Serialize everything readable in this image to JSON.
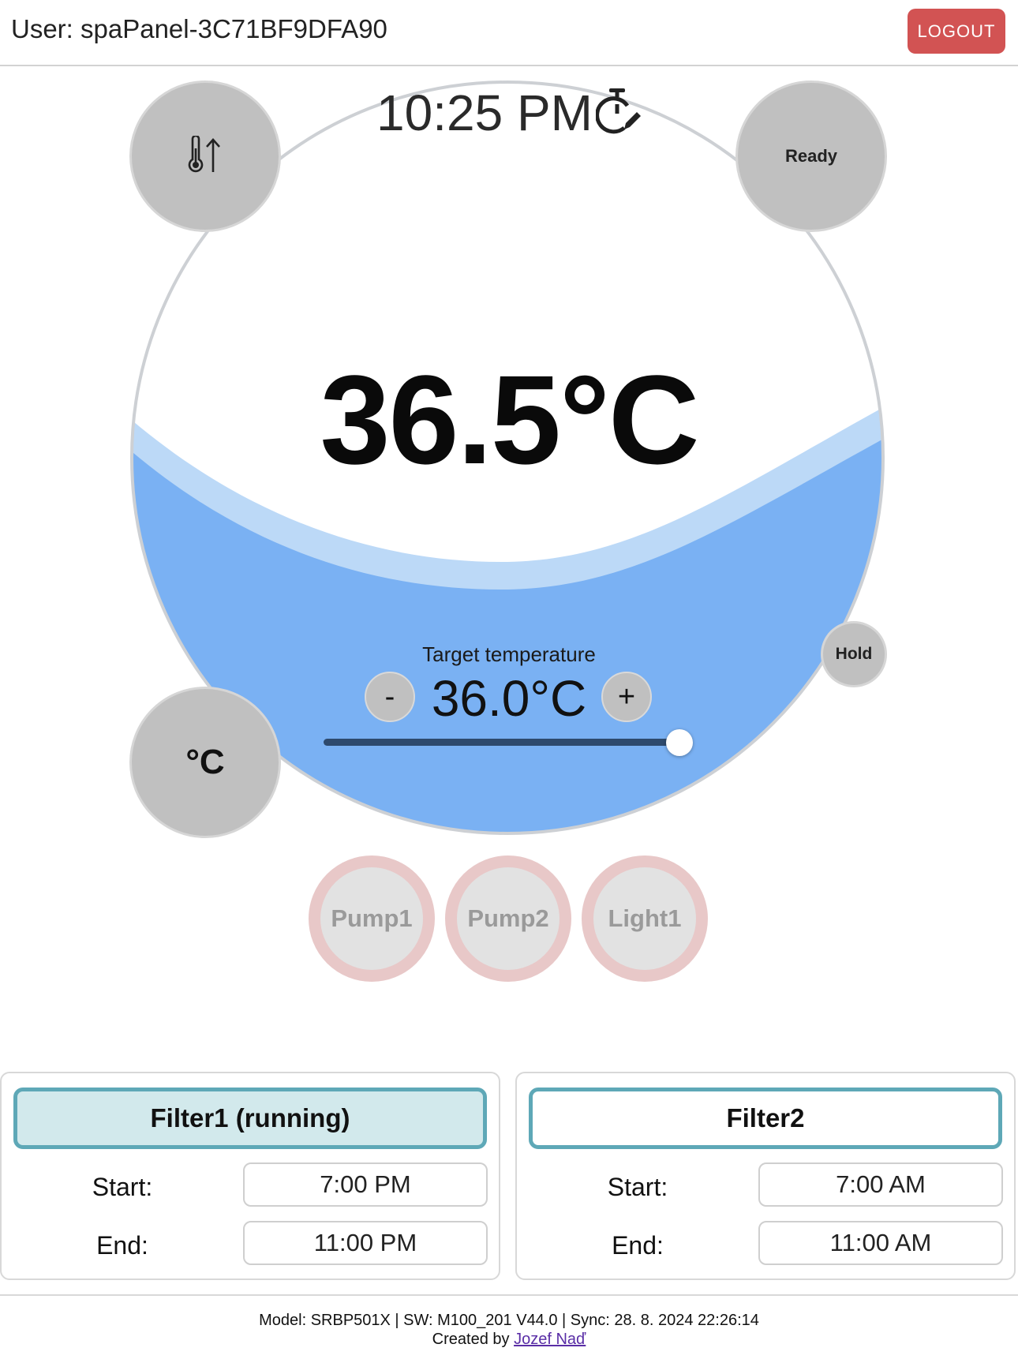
{
  "header": {
    "user_label": "User: spaPanel-3C71BF9DFA90",
    "logout_label": "LOGOUT"
  },
  "dial": {
    "clock_time": "10:25 PM",
    "current_temperature": "36.5°C",
    "target_label": "Target temperature",
    "target_value": "36.0°C",
    "minus_label": "-",
    "plus_label": "+",
    "target_slider_fraction": 1.0
  },
  "buttons": {
    "heat_icon": "thermometer-up-icon",
    "ready_label": "Ready",
    "unit_label": "°C",
    "hold_label": "Hold"
  },
  "devices": [
    {
      "label": "Pump1"
    },
    {
      "label": "Pump2"
    },
    {
      "label": "Light1"
    }
  ],
  "filters": [
    {
      "title": "Filter1 (running)",
      "start_label": "Start:",
      "start_value": "7:00 PM",
      "end_label": "End:",
      "end_value": "11:00 PM"
    },
    {
      "title": "Filter2",
      "start_label": "Start:",
      "start_value": "7:00 AM",
      "end_label": "End:",
      "end_value": "11:00 AM"
    }
  ],
  "footer": {
    "info": "Model: SRBP501X | SW: M100_201 V44.0 | Sync: 28. 8. 2024 22:26:14",
    "created_by": "Created by",
    "author": "Jozef Naď"
  },
  "colors": {
    "water": "#7ab1f3",
    "wave_highlight": "#bcd9f7",
    "logout": "#d25353",
    "filter_border": "#5ea8b7",
    "filter_running_bg": "#d2e9ec",
    "device_ring": "#e8c8c8"
  }
}
